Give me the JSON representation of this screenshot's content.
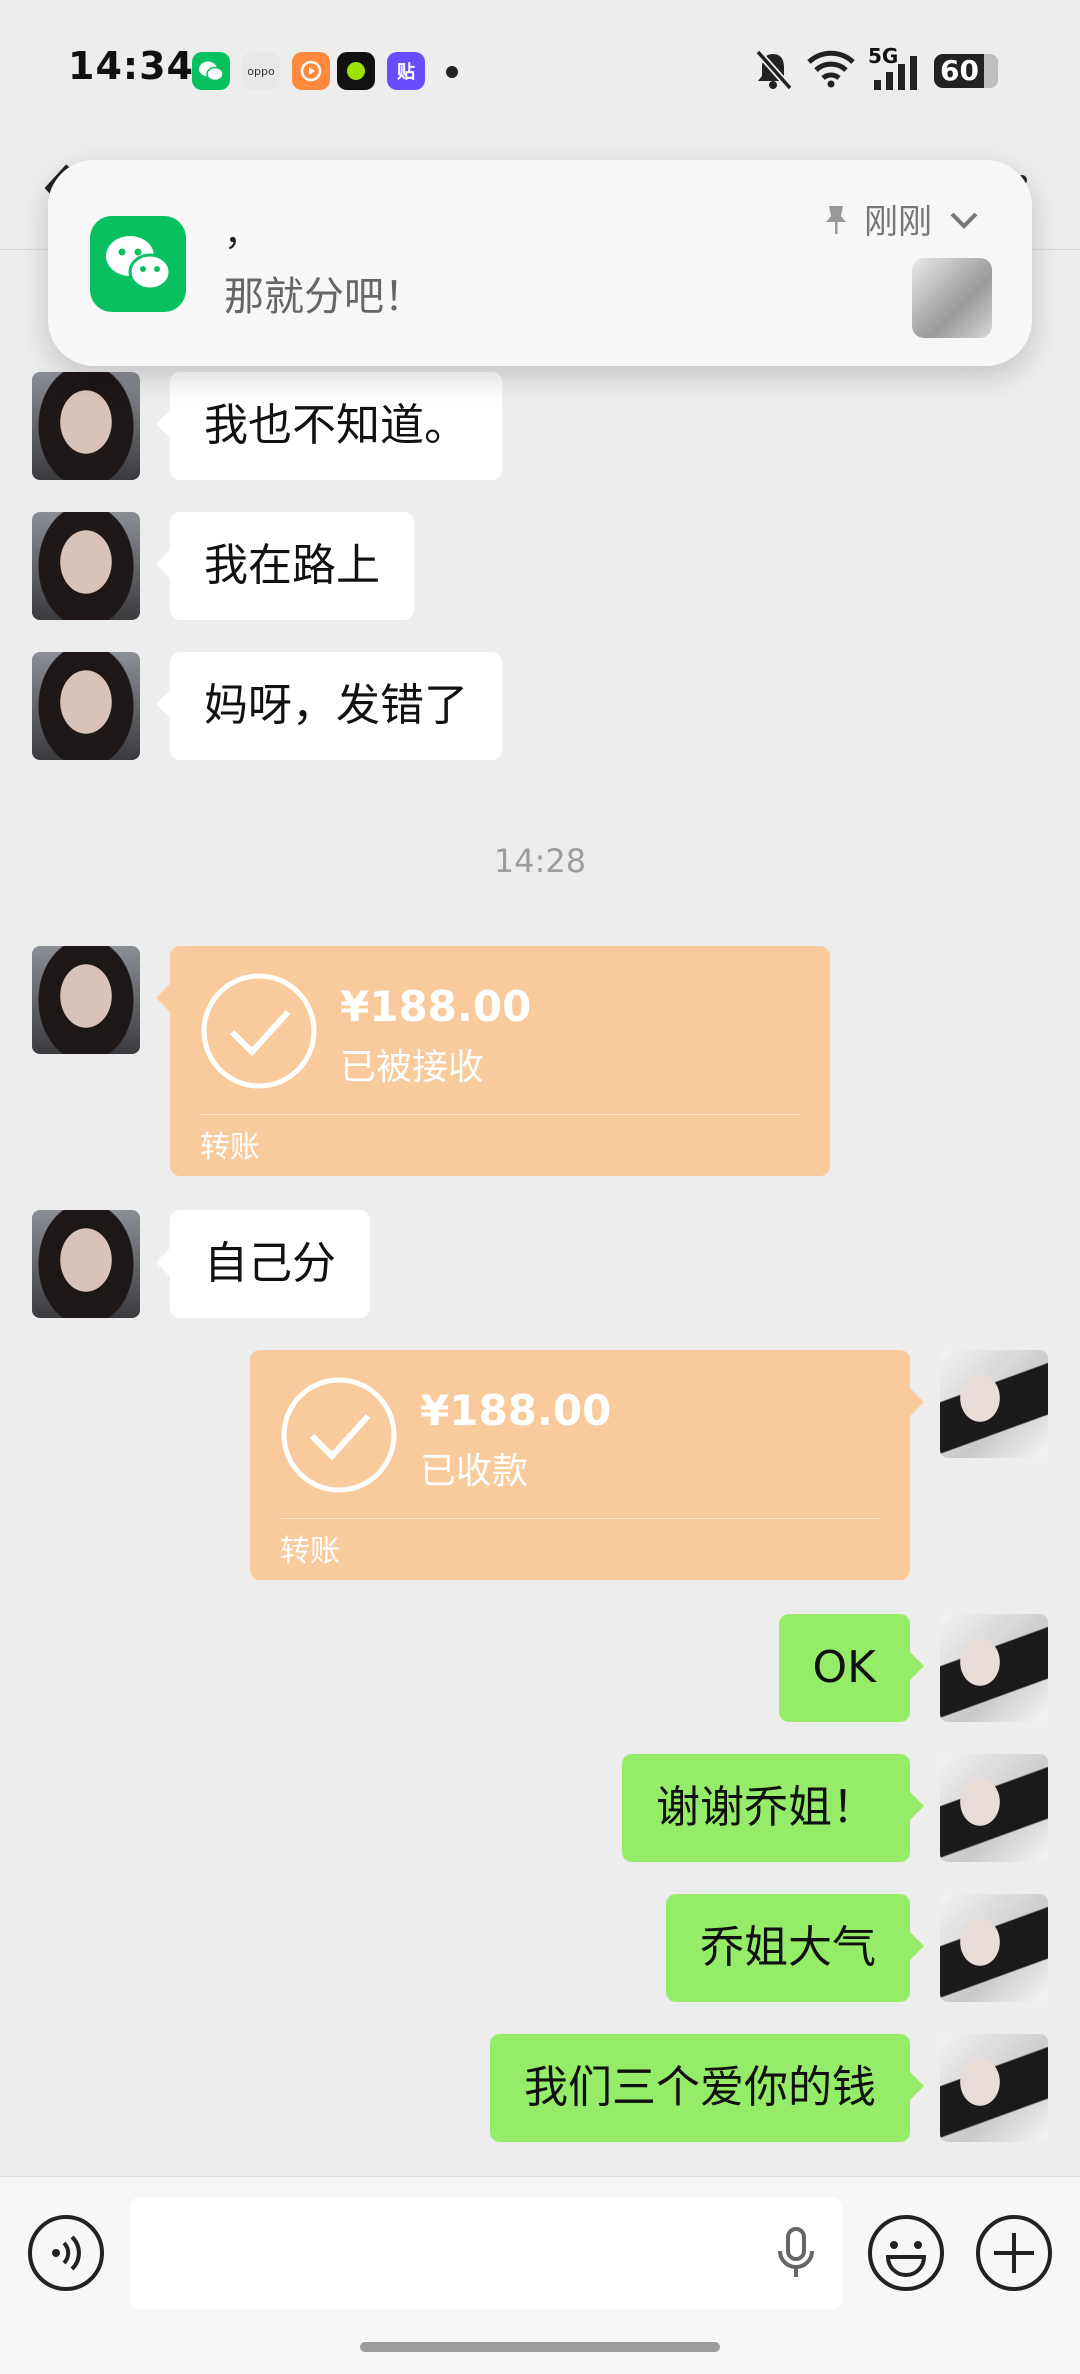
{
  "status_bar": {
    "time": "14:34",
    "apps": [
      {
        "icon": "wechat-icon",
        "color": "#07c160"
      },
      {
        "icon": "oppo-icon",
        "color": "#e8e8e8",
        "text": "oppo"
      },
      {
        "icon": "video-app-icon",
        "color": "#ff8a3d"
      },
      {
        "icon": "green-dot-app-icon",
        "color": "#111111"
      },
      {
        "icon": "sticker-app-icon",
        "color": "#6a4cff",
        "text": "贴"
      }
    ],
    "network": "5G",
    "battery": "60"
  },
  "notification": {
    "app_icon": "wechat-icon",
    "title": "，",
    "body": "那就分吧！",
    "time": "刚刚"
  },
  "messages": [
    {
      "side": "in",
      "text": "我也不知道。"
    },
    {
      "side": "in",
      "text": "我在路上"
    },
    {
      "side": "in",
      "text": "妈呀，发错了"
    }
  ],
  "timestamp": "14:28",
  "transfers": [
    {
      "side": "in",
      "amount": "¥188.00",
      "status": "已被接收",
      "label": "转账"
    },
    {
      "side": "out",
      "amount": "¥188.00",
      "status": "已收款",
      "label": "转账"
    }
  ],
  "messages_after": [
    {
      "side": "in",
      "text": "自己分"
    },
    {
      "side": "out",
      "text": "OK"
    },
    {
      "side": "out",
      "text": "谢谢乔姐！"
    },
    {
      "side": "out",
      "text": "乔姐大气"
    },
    {
      "side": "out",
      "text": "我们三个爱你的钱"
    }
  ],
  "input_bar": {
    "voice_icon": "voice-mode-icon",
    "emoji_icon": "emoji-icon",
    "plus_icon": "plus-circle-icon",
    "mic_icon": "microphone-icon"
  },
  "colors": {
    "background": "#ededed",
    "incoming_bubble": "#ffffff",
    "outgoing_bubble": "#95ec69",
    "transfer_card": "#f9cb9c",
    "wechat_green": "#07c160"
  }
}
